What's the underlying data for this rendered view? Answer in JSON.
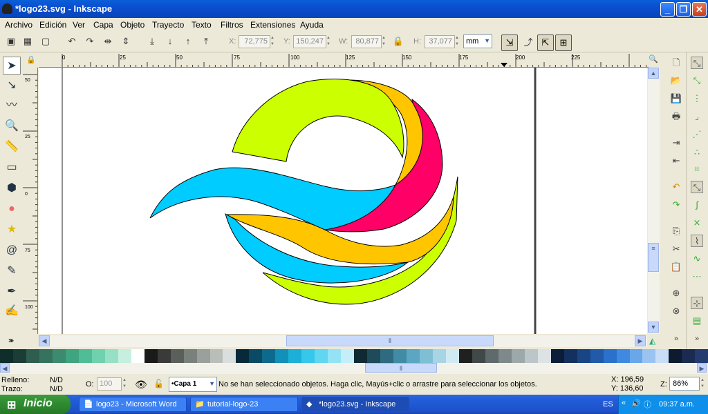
{
  "window": {
    "title": "*logo23.svg - Inkscape",
    "minimize": "_",
    "maximize": "❐",
    "close": "✕"
  },
  "menu": [
    "Archivo",
    "Edición",
    "Ver",
    "Capa",
    "Objeto",
    "Trayecto",
    "Texto",
    "Filtros",
    "Extensiones",
    "Ayuda"
  ],
  "toolbar": {
    "x_label": "X:",
    "x_value": "72,775",
    "y_label": "Y:",
    "y_value": "150,247",
    "w_label": "W:",
    "w_value": "80,877",
    "h_label": "H:",
    "h_value": "37,077",
    "unit": "mm"
  },
  "ruler": {
    "h_ticks": [
      "0",
      "25",
      "50",
      "75",
      "100",
      "125",
      "150",
      "175",
      "200",
      "225"
    ],
    "v_ticks": [
      "50",
      "25",
      "0",
      "75",
      "100"
    ]
  },
  "palette": [
    "#0d2e2a",
    "#1b3d36",
    "#2f5d4f",
    "#35735f",
    "#3c8a6f",
    "#3fa480",
    "#4fbd96",
    "#70d1ae",
    "#98e0c5",
    "#c6efe0",
    "#ffffff",
    "#1a1a1a",
    "#3a3a3a",
    "#5a5f5c",
    "#7a817d",
    "#9aa09c",
    "#babebb",
    "#dadedc",
    "#062a3a",
    "#0b4a64",
    "#0e6a8c",
    "#1190b8",
    "#1cb0d8",
    "#35c8ea",
    "#60d6f0",
    "#94e3f4",
    "#c4eff8",
    "#102a33",
    "#1f4a59",
    "#2f6b80",
    "#418ba5",
    "#5ba7c2",
    "#7fbfd5",
    "#a7d5e5",
    "#d0eaf2",
    "#202020",
    "#404848",
    "#5e6a6c",
    "#7d898b",
    "#9da8aa",
    "#bcc6c8",
    "#dde3e4",
    "#0c1d3a",
    "#13305e",
    "#1a4584",
    "#205aa8",
    "#2a71cc",
    "#3f8ae0",
    "#6aa6ea",
    "#9bc3f2",
    "#c8def8",
    "#0e1a30",
    "#1a2a50",
    "#243b70"
  ],
  "status": {
    "fill_label": "Relleno:",
    "fill_value": "N/D",
    "stroke_label": "Trazo:",
    "stroke_value": "N/D",
    "opacity_label": "O:",
    "opacity_value": "100",
    "layer": "•Capa 1",
    "message": "No se han seleccionado objetos. Haga clic, Mayús+clic o arrastre para seleccionar los objetos.",
    "x_coord": "X:  196,59",
    "y_coord": "Y:  136,60",
    "zoom_label": "Z:",
    "zoom_value": "86%"
  },
  "taskbar": {
    "start": "Inicio",
    "tasks": [
      "logo23 - Microsoft Word",
      "tutorial-logo-23",
      "*logo23.svg - Inkscape"
    ],
    "lang": "ES",
    "clock": "09:37 a.m."
  },
  "logo_colors": {
    "lime": "#ccff00",
    "orange": "#ffc600",
    "magenta": "#ff0066",
    "cyan": "#00ccff"
  }
}
